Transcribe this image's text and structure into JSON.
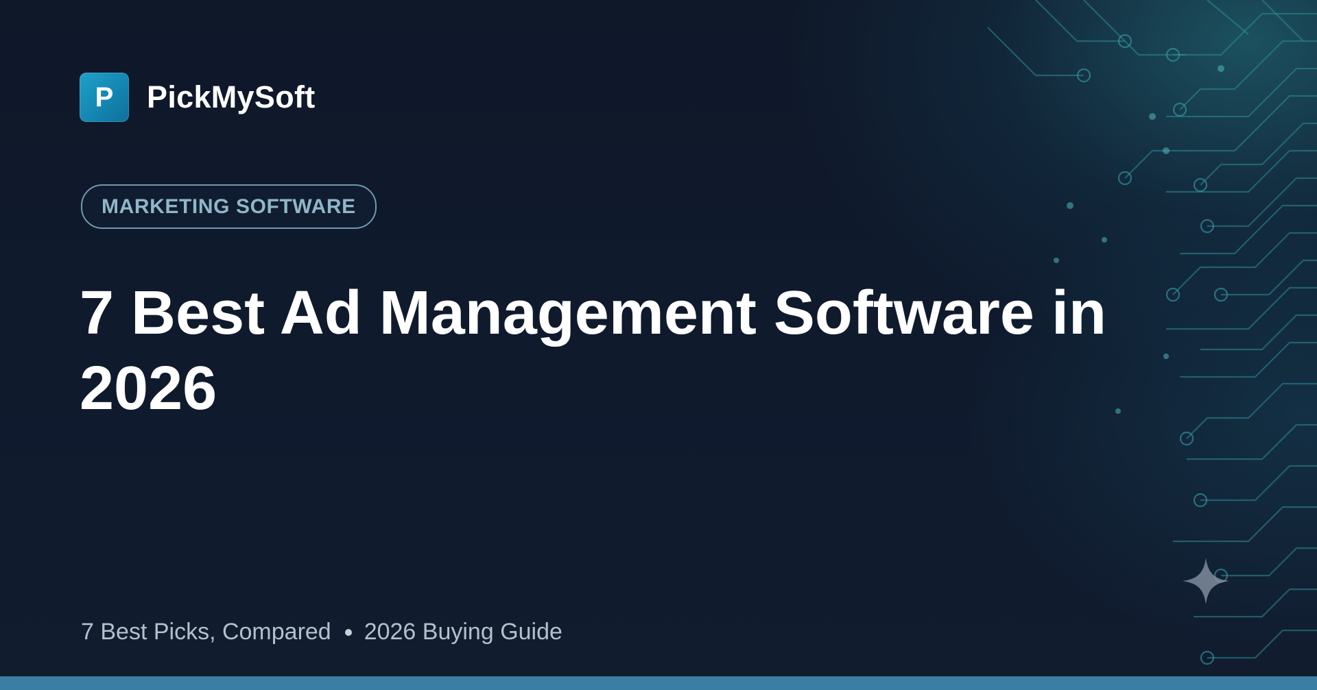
{
  "brand": {
    "logo_letter": "P",
    "name": "PickMySoft"
  },
  "category": {
    "label": "MARKETING SOFTWARE"
  },
  "article": {
    "title": "7 Best Ad Management Software in 2026"
  },
  "meta": {
    "picks": "7 Best Picks, Compared",
    "guide": "2026 Buying Guide"
  },
  "colors": {
    "background": "#0d1527",
    "accent_teal": "#1fa0c8",
    "pill_border": "#6e9bb1",
    "pill_text": "#8fb7c7",
    "bottom_bar": "#3a7fa3"
  },
  "icons": {
    "logo": "p-logo-icon",
    "decoration": "sparkle-icon",
    "separator": "bullet-dot-icon"
  }
}
